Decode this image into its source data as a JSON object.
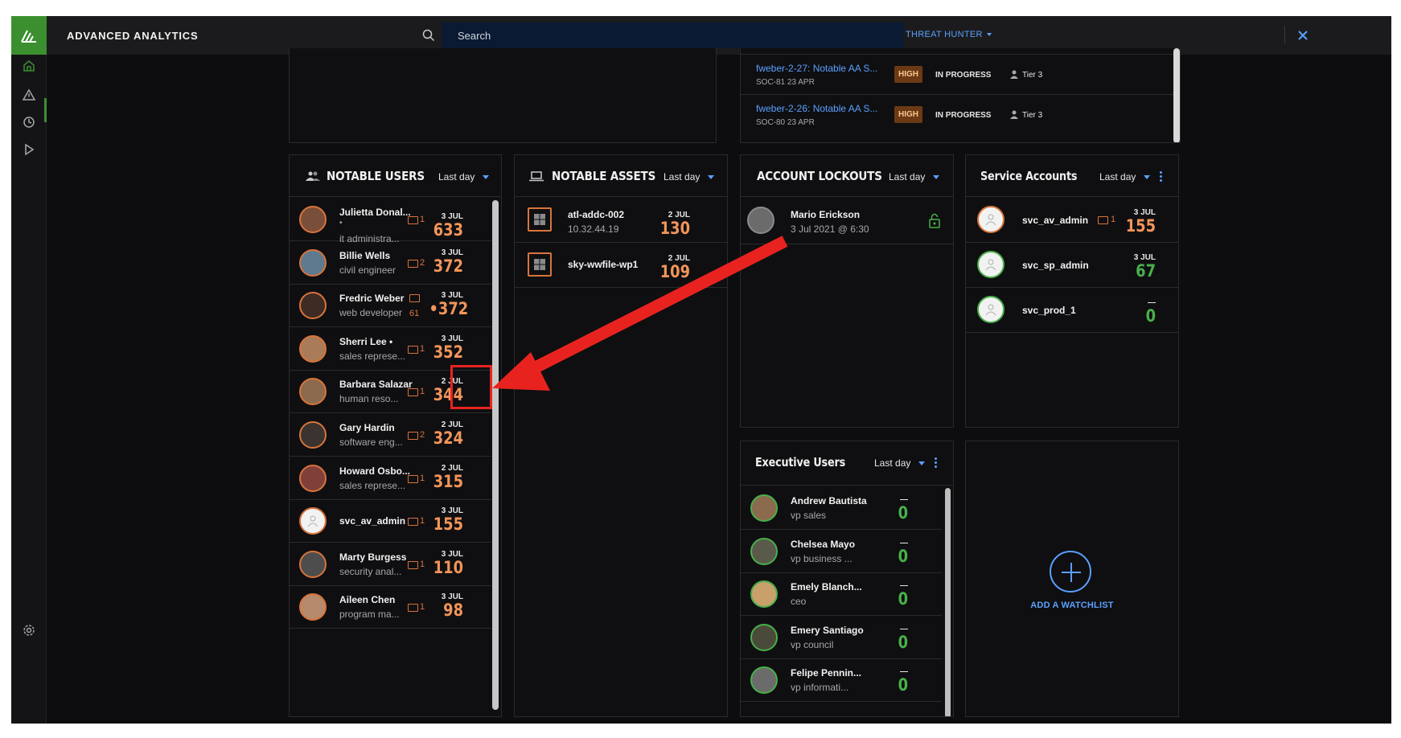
{
  "app": {
    "title": "ADVANCED ANALYTICS",
    "search_placeholder": "Search",
    "role_menu": "THREAT HUNTER",
    "accent": "#5aa0ff",
    "brand_green": "#3b8f2f"
  },
  "nav": {
    "items": [
      "home-icon",
      "alert-icon",
      "history-icon",
      "play-icon",
      "settings-icon"
    ]
  },
  "incidents": [
    {
      "title": "fweber-2-27: Notable AA S...",
      "sub": "SOC-81  23 APR",
      "severity": "HIGH",
      "status": "IN PROGRESS",
      "tier": "Tier 3"
    },
    {
      "title": "fweber-2-26: Notable AA S...",
      "sub": "SOC-80  23 APR",
      "severity": "HIGH",
      "status": "IN PROGRESS",
      "tier": "Tier 3"
    }
  ],
  "notable_users": {
    "title": "NOTABLE USERS",
    "range": "Last day",
    "rows": [
      {
        "name": "Julietta Donal...",
        "extra": "•",
        "role": "it administra...",
        "folders": "1",
        "date": "3 JUL",
        "score": "633"
      },
      {
        "name": "Billie Wells",
        "role": "civil engineer",
        "folders": "2",
        "date": "3 JUL",
        "score": "372"
      },
      {
        "name": "Fredric Weber",
        "role": "web developer",
        "folders": "61",
        "date": "3 JUL",
        "score": "•372"
      },
      {
        "name": "Sherri Lee •",
        "role": "sales represe...",
        "folders": "1",
        "date": "3 JUL",
        "score": "352"
      },
      {
        "name": "Barbara Salazar",
        "role": "human reso...",
        "folders": "1",
        "date": "2 JUL",
        "score": "344"
      },
      {
        "name": "Gary Hardin",
        "role": "software eng...",
        "folders": "2",
        "date": "2 JUL",
        "score": "324"
      },
      {
        "name": "Howard Osbo...",
        "role": "sales represe...",
        "folders": "1",
        "date": "2 JUL",
        "score": "315"
      },
      {
        "name": "svc_av_admin",
        "role": "",
        "folders": "1",
        "date": "3 JUL",
        "score": "155"
      },
      {
        "name": "Marty Burgess",
        "role": "security anal...",
        "folders": "1",
        "date": "3 JUL",
        "score": "110"
      },
      {
        "name": "Aileen Chen",
        "role": "program ma...",
        "folders": "1",
        "date": "3 JUL",
        "score": "98"
      }
    ]
  },
  "notable_assets": {
    "title": "NOTABLE ASSETS",
    "range": "Last day",
    "rows": [
      {
        "name": "atl-addc-002",
        "ip": "10.32.44.19",
        "date": "2 JUL",
        "score": "130"
      },
      {
        "name": "sky-wwfile-wp1",
        "ip": "",
        "date": "2 JUL",
        "score": "109"
      }
    ]
  },
  "account_lockouts": {
    "title": "ACCOUNT LOCKOUTS",
    "range": "Last day",
    "rows": [
      {
        "name": "Mario Erickson",
        "when": "3 Jul 2021 @ 6:30"
      }
    ]
  },
  "service_accounts": {
    "title": "Service Accounts",
    "range": "Last day",
    "rows": [
      {
        "name": "svc_av_admin",
        "folders": "1",
        "date": "3 JUL",
        "score": "155",
        "color": "#f2955a"
      },
      {
        "name": "svc_sp_admin",
        "folders": "",
        "date": "3 JUL",
        "score": "67",
        "color": "#49b04a"
      },
      {
        "name": "svc_prod_1",
        "folders": "",
        "date": "—",
        "score": "0",
        "color": "#49b04a"
      }
    ]
  },
  "executive_users": {
    "title": "Executive Users",
    "range": "Last day",
    "rows": [
      {
        "name": "Andrew Bautista",
        "role": "vp sales",
        "date": "—",
        "score": "0"
      },
      {
        "name": "Chelsea Mayo",
        "role": "vp business ...",
        "date": "—",
        "score": "0"
      },
      {
        "name": "Emely Blanch...",
        "role": "ceo",
        "date": "—",
        "score": "0"
      },
      {
        "name": "Emery Santiago",
        "role": "vp council",
        "date": "—",
        "score": "0"
      },
      {
        "name": "Felipe Pennin...",
        "role": "vp informati...",
        "date": "—",
        "score": "0"
      }
    ]
  },
  "watchlist": {
    "add_label": "ADD A WATCHLIST"
  },
  "annotation": {
    "color": "#e8231f"
  }
}
